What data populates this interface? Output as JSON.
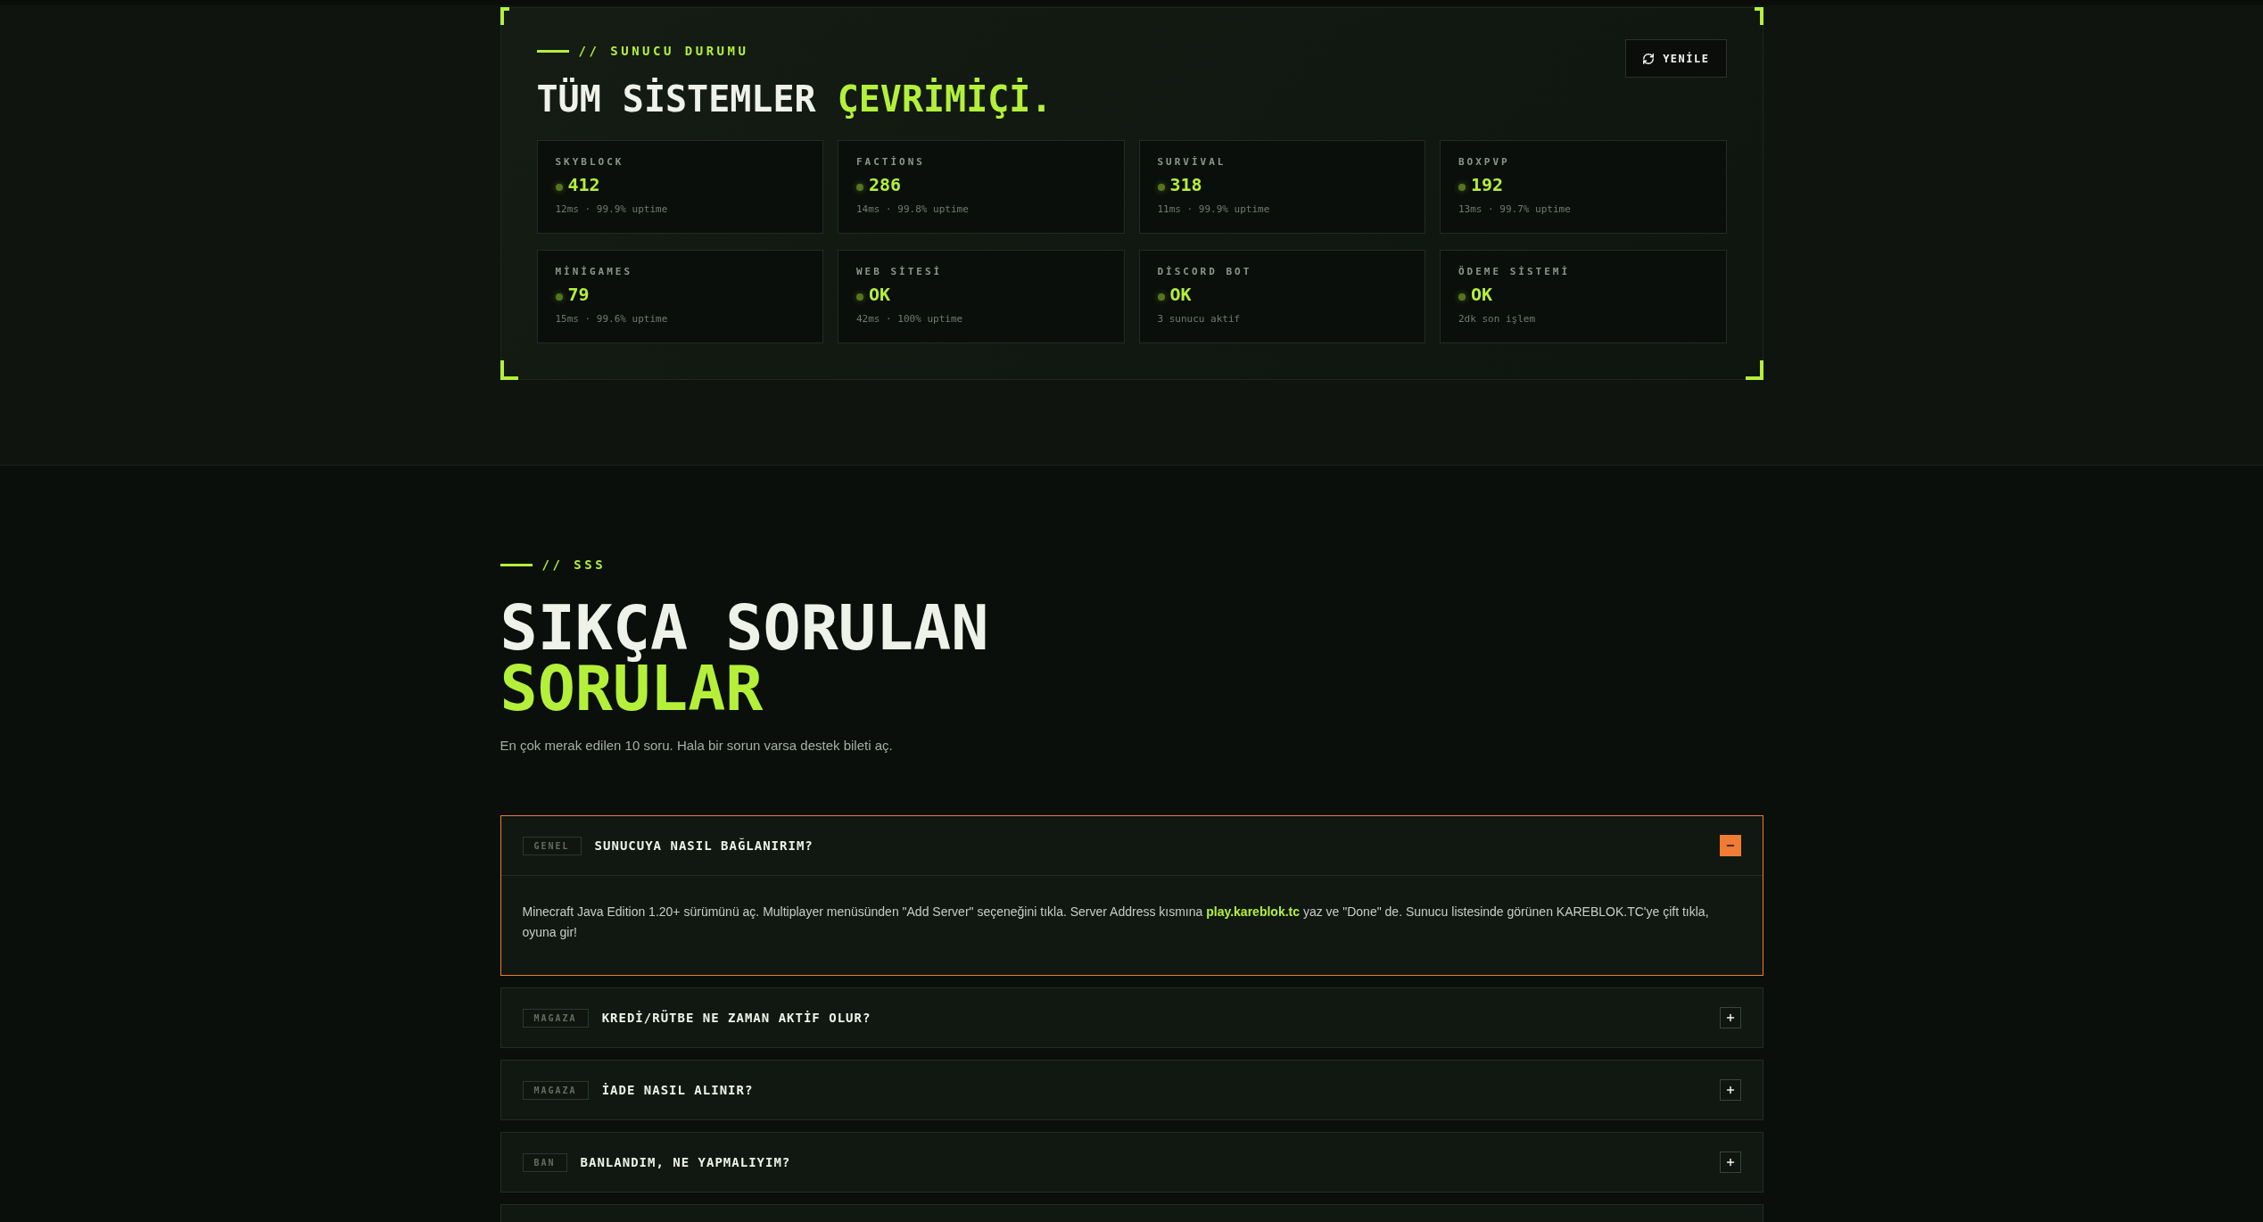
{
  "status": {
    "label": "// SUNUCU DURUMU",
    "title": "TÜM SİSTEMLER **ÇEVRİMİÇİ.**",
    "refresh_button": "YENİLE",
    "servers": [
      {
        "name": "SKYBLOCK",
        "online": true,
        "value": "412",
        "detail": "12ms · 99.9% uptime"
      },
      {
        "name": "FACTİONS",
        "online": true,
        "value": "286",
        "detail": "14ms · 99.8% uptime"
      },
      {
        "name": "SURVİVAL",
        "online": true,
        "value": "318",
        "detail": "11ms · 99.9% uptime"
      },
      {
        "name": "BOXPVP",
        "online": true,
        "value": "192",
        "detail": "13ms · 99.7% uptime"
      },
      {
        "name": "MİNİGAMES",
        "online": true,
        "value": "79",
        "detail": "15ms · 99.6% uptime"
      },
      {
        "name": "WEB SİTESİ",
        "online": true,
        "value": "OK",
        "detail": "42ms · 100% uptime"
      },
      {
        "name": "DİSCORD BOT",
        "online": true,
        "value": "OK",
        "detail": "3 sunucu aktif"
      },
      {
        "name": "ÖDEME SİSTEMİ",
        "online": true,
        "value": "OK",
        "detail": "2dk son işlem"
      }
    ]
  },
  "faq": {
    "label": "// SSS",
    "title": "SIKÇA SORULAN **SORULAR**",
    "subtitle": "En çok merak edilen 10 soru. Hala bir sorun varsa destek bileti aç.",
    "items": [
      {
        "tag": "GENEL",
        "question": "SUNUCUYA NASIL BAĞLANIRIM?",
        "expanded": true,
        "answer": "Minecraft Java Edition 1.20+ sürümünü aç. Multiplayer menüsünden \"Add Server\" seçeneğini tıkla. Server Address kısmına **play.kareblok.tc** yaz ve \"Done\" de. Sunucu listesinde görünen KAREBLOK.TC'ye çift tıkla, oyuna gir!"
      },
      {
        "tag": "MAGAZA",
        "question": "KREDİ/RÜTBE NE ZAMAN AKTİF OLUR?",
        "expanded": false
      },
      {
        "tag": "MAGAZA",
        "question": "İADE NASIL ALINIR?",
        "expanded": false
      },
      {
        "tag": "BAN",
        "question": "BANLANDIM, NE YAPMALIYIM?",
        "expanded": false
      }
    ]
  }
}
